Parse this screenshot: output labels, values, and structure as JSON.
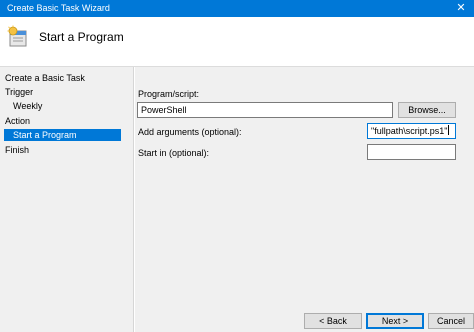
{
  "window": {
    "title": "Create Basic Task Wizard",
    "close_glyph": "✕"
  },
  "header": {
    "title": "Start a Program",
    "icon": "task-scheduler-wizard-icon"
  },
  "sidebar": {
    "items": [
      {
        "label": "Create a Basic Task",
        "selected": false
      },
      {
        "label": "Trigger",
        "selected": false
      },
      {
        "label": "Weekly",
        "selected": false
      },
      {
        "label": "Action",
        "selected": false
      },
      {
        "label": "Start a Program",
        "selected": true
      },
      {
        "label": "Finish",
        "selected": false
      }
    ]
  },
  "form": {
    "program_label": "Program/script:",
    "program_value": "PowerShell",
    "browse_label": "Browse...",
    "arguments_label": "Add arguments (optional):",
    "arguments_value": "\"fullpath\\script.ps1\"",
    "start_in_label": "Start in (optional):",
    "start_in_value": ""
  },
  "footer": {
    "back_label": "< Back",
    "next_label": "Next >",
    "cancel_label": "Cancel"
  },
  "colors": {
    "accent": "#0078d7",
    "panel_bg": "#f0f0f0"
  }
}
